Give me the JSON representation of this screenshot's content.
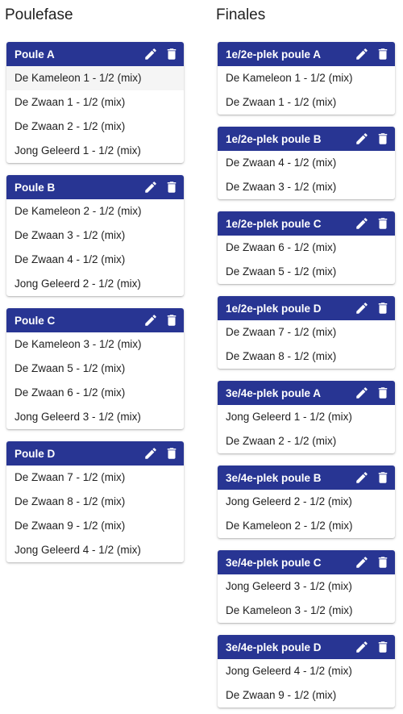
{
  "poule": {
    "title": "Poulefase",
    "cards": [
      {
        "title": "Poule A",
        "teams": [
          "De Kameleon 1 - 1/2 (mix)",
          "De Zwaan 1 - 1/2 (mix)",
          "De Zwaan 2 - 1/2 (mix)",
          "Jong Geleerd 1 - 1/2 (mix)"
        ]
      },
      {
        "title": "Poule B",
        "teams": [
          "De Kameleon 2 - 1/2 (mix)",
          "De Zwaan 3 - 1/2 (mix)",
          "De Zwaan 4 - 1/2 (mix)",
          "Jong Geleerd 2 - 1/2 (mix)"
        ]
      },
      {
        "title": "Poule C",
        "teams": [
          "De Kameleon 3 - 1/2 (mix)",
          "De Zwaan 5 - 1/2 (mix)",
          "De Zwaan 6 - 1/2 (mix)",
          "Jong Geleerd 3 - 1/2 (mix)"
        ]
      },
      {
        "title": "Poule D",
        "teams": [
          "De Zwaan 7 - 1/2 (mix)",
          "De Zwaan 8 - 1/2 (mix)",
          "De Zwaan 9 - 1/2 (mix)",
          "Jong Geleerd 4 - 1/2 (mix)"
        ]
      }
    ]
  },
  "finales": {
    "title": "Finales",
    "cards": [
      {
        "title": "1e/2e-plek poule A",
        "teams": [
          "De Kameleon 1 - 1/2 (mix)",
          "De Zwaan 1 - 1/2 (mix)"
        ]
      },
      {
        "title": "1e/2e-plek poule B",
        "teams": [
          "De Zwaan 4 - 1/2 (mix)",
          "De Zwaan 3 - 1/2 (mix)"
        ]
      },
      {
        "title": "1e/2e-plek poule C",
        "teams": [
          "De Zwaan 6 - 1/2 (mix)",
          "De Zwaan 5 - 1/2 (mix)"
        ]
      },
      {
        "title": "1e/2e-plek poule D",
        "teams": [
          "De Zwaan 7 - 1/2 (mix)",
          "De Zwaan 8 - 1/2 (mix)"
        ]
      },
      {
        "title": "3e/4e-plek poule A",
        "teams": [
          "Jong Geleerd 1 - 1/2 (mix)",
          "De Zwaan 2 - 1/2 (mix)"
        ]
      },
      {
        "title": "3e/4e-plek poule B",
        "teams": [
          "Jong Geleerd 2 - 1/2 (mix)",
          "De Kameleon 2 - 1/2 (mix)"
        ]
      },
      {
        "title": "3e/4e-plek poule C",
        "teams": [
          "Jong Geleerd 3 - 1/2 (mix)",
          "De Kameleon 3 - 1/2 (mix)"
        ]
      },
      {
        "title": "3e/4e-plek poule D",
        "teams": [
          "Jong Geleerd 4 - 1/2 (mix)",
          "De Zwaan 9 - 1/2 (mix)"
        ]
      }
    ]
  },
  "icons": {
    "edit": "pencil-icon",
    "delete": "trash-icon"
  },
  "colors": {
    "header": "#283593",
    "hover_row": "#f5f5f5"
  }
}
